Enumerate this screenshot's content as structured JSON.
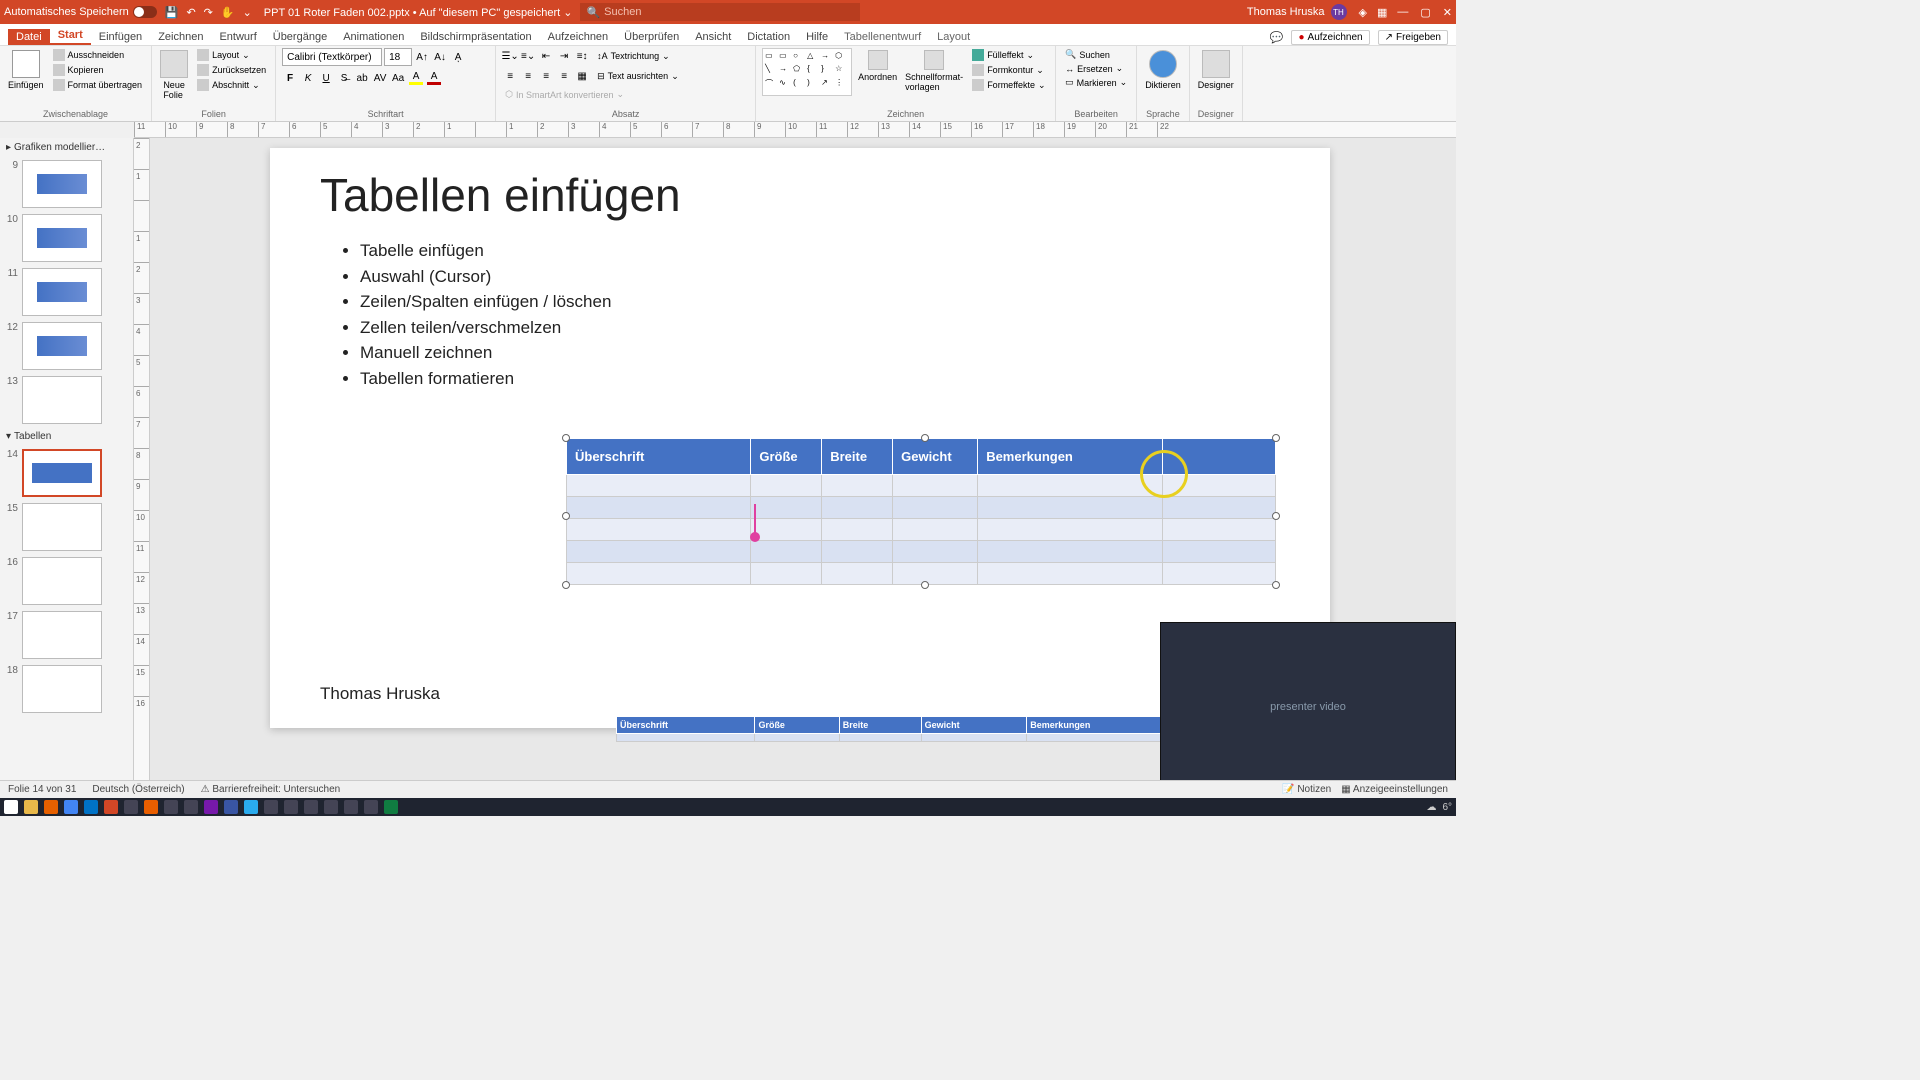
{
  "titlebar": {
    "autosave_label": "Automatisches Speichern",
    "filename": "PPT 01 Roter Faden 002.pptx • Auf \"diesem PC\" gespeichert ⌄",
    "search_placeholder": "Suchen",
    "user_name": "Thomas Hruska",
    "user_initials": "TH"
  },
  "tabs": {
    "file": "Datei",
    "start": "Start",
    "insert": "Einfügen",
    "draw": "Zeichnen",
    "design": "Entwurf",
    "transitions": "Übergänge",
    "animations": "Animationen",
    "slideshow": "Bildschirmpräsentation",
    "record": "Aufzeichnen",
    "review": "Überprüfen",
    "view": "Ansicht",
    "dictation": "Dictation",
    "help": "Hilfe",
    "tabledesign": "Tabellenentwurf",
    "layout": "Layout",
    "record_btn": "Aufzeichnen",
    "share_btn": "Freigeben"
  },
  "ribbon": {
    "clipboard": {
      "label": "Zwischenablage",
      "paste": "Einfügen",
      "cut": "Ausschneiden",
      "copy": "Kopieren",
      "format_painter": "Format übertragen"
    },
    "slides": {
      "label": "Folien",
      "new_slide": "Neue\nFolie",
      "layout": "Layout",
      "reset": "Zurücksetzen",
      "section": "Abschnitt"
    },
    "font": {
      "label": "Schriftart",
      "name": "Calibri (Textkörper)",
      "size": "18"
    },
    "paragraph": {
      "label": "Absatz",
      "text_direction": "Textrichtung",
      "align_text": "Text ausrichten",
      "smartart": "In SmartArt konvertieren"
    },
    "drawing": {
      "label": "Zeichnen",
      "arrange": "Anordnen",
      "quick_styles": "Schnellformat-\nvorlagen",
      "fill": "Fülleffekt",
      "outline": "Formkontur",
      "effects": "Formeffekte"
    },
    "editing": {
      "label": "Bearbeiten",
      "find": "Suchen",
      "replace": "Ersetzen",
      "select": "Markieren"
    },
    "voice": {
      "label": "Sprache",
      "dictate": "Diktieren"
    },
    "designer": {
      "label": "Designer",
      "designer_btn": "Designer"
    }
  },
  "ruler_values": [
    "11",
    "10",
    "9",
    "8",
    "7",
    "6",
    "5",
    "4",
    "3",
    "2",
    "1",
    "",
    "1",
    "2",
    "3",
    "4",
    "5",
    "6",
    "7",
    "8",
    "9",
    "10",
    "11",
    "12",
    "13",
    "14",
    "15",
    "16",
    "17",
    "18",
    "19",
    "20",
    "21",
    "22"
  ],
  "vruler_values": [
    "2",
    "1",
    "",
    "1",
    "2",
    "3",
    "4",
    "5",
    "6",
    "7",
    "8",
    "9",
    "10",
    "11",
    "12",
    "13",
    "14",
    "15",
    "16"
  ],
  "panel": {
    "section1": "Grafiken modellier…",
    "section2": "Tabellen",
    "thumbs": [
      "9",
      "10",
      "11",
      "12",
      "13",
      "14",
      "15",
      "16",
      "17",
      "18"
    ]
  },
  "slide": {
    "title": "Tabellen einfügen",
    "bullets": [
      "Tabelle einfügen",
      "Auswahl (Cursor)",
      "Zeilen/Spalten einfügen / löschen",
      "Zellen teilen/verschmelzen",
      "Manuell zeichnen",
      "Tabellen formatieren"
    ],
    "author": "Thomas Hruska",
    "table_headers": [
      "Überschrift",
      "Größe",
      "Breite",
      "Gewicht",
      "Bemerkungen",
      ""
    ],
    "table_widths": [
      "26%",
      "10%",
      "10%",
      "12%",
      "26%",
      "16%"
    ]
  },
  "status": {
    "slide_of": "Folie 14 von 31",
    "language": "Deutsch (Österreich)",
    "accessibility": "Barrierefreiheit: Untersuchen",
    "notes": "Notizen",
    "display_settings": "Anzeigeeinstellungen"
  },
  "taskbar": {
    "temp": "6°"
  }
}
